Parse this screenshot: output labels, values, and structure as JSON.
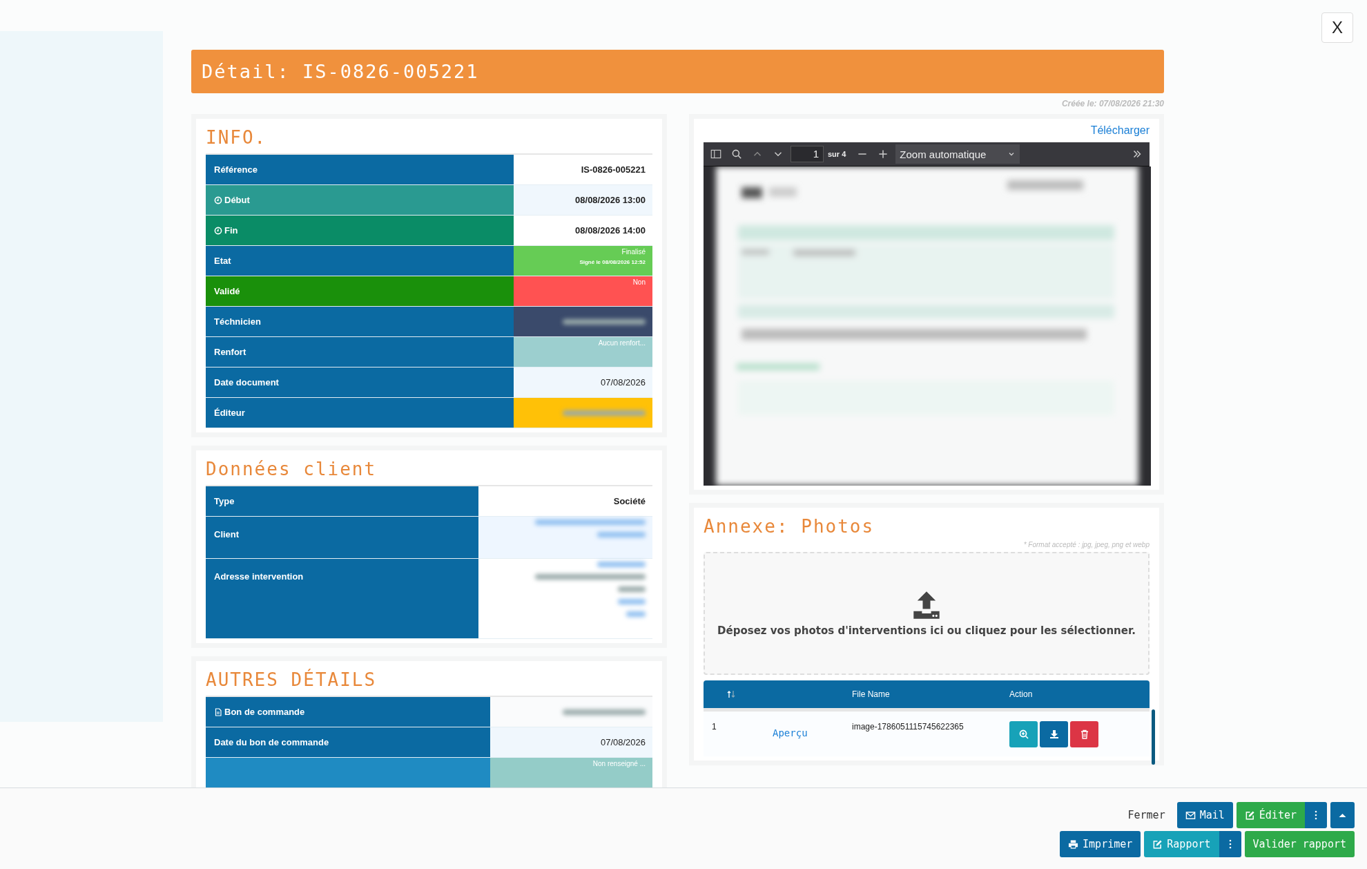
{
  "close_button": {
    "label": "X"
  },
  "header": {
    "title": "Détail: IS-0826-005221"
  },
  "created": {
    "label": "Créée le:",
    "value": "07/08/2026 21:30"
  },
  "info": {
    "title": "INFO.",
    "rows": [
      {
        "label": "Référence",
        "color": "#0b6aa2",
        "kind": "bold",
        "value": {
          "text": "IS-0826-005221"
        }
      },
      {
        "label": "Début",
        "color": "#2a9a91",
        "kind": "bold",
        "value": {
          "text": "08/08/2026 13:00"
        }
      },
      {
        "label": "Fin",
        "color": "#0a8c66",
        "kind": "bold",
        "value": {
          "text": "08/08/2026 14:00"
        }
      },
      {
        "label": "Etat",
        "color": "#0b6aa2",
        "kind": "badge",
        "value": {
          "text": "Finalisé",
          "note": "Signé le 08/08/2026 12:52",
          "color": "#66cc55"
        }
      },
      {
        "label": "Validé",
        "color": "#1a900b",
        "kind": "badge",
        "value": {
          "text": "Non",
          "color": "#ff5252"
        }
      },
      {
        "label": "Téchnicien",
        "color": "#0b6aa2",
        "kind": "blurred",
        "value": {
          "color": "#3a4a6b"
        }
      },
      {
        "label": "Renfort",
        "color": "#0b6aa2",
        "kind": "badge",
        "value": {
          "text": "Aucun renfort...",
          "color": "#9ccfcf"
        }
      },
      {
        "label": "Date document",
        "color": "#0b6aa2",
        "kind": "plain",
        "value": {
          "text": "07/08/2026"
        }
      },
      {
        "label": "Éditeur",
        "color": "#0b6aa2",
        "kind": "blurred",
        "value": {
          "color": "#ffc107"
        }
      }
    ]
  },
  "client": {
    "title": "Données client",
    "rows": [
      {
        "label": "Type",
        "color": "#0b6aa2",
        "kind": "bold",
        "value": {
          "text": "Société"
        }
      },
      {
        "label": "Client",
        "color": "#0b6aa2",
        "kind": "blurred_link",
        "value": {
          "color": "#eef6ff"
        }
      },
      {
        "label": "Adresse intervention",
        "color": "#0b6aa2",
        "kind": "blurred_address",
        "value": {
          "color": "#ffffff"
        }
      }
    ]
  },
  "other": {
    "title": "AUTRES DÉTAILS",
    "rows": [
      {
        "label": "Bon de commande",
        "color": "#0b6aa2",
        "kind": "blurred",
        "value": {
          "color": "#fafbfc"
        }
      },
      {
        "label": "Date du bon de commande",
        "color": "#0b6aa2",
        "kind": "plain",
        "value": {
          "text": "07/08/2026"
        }
      },
      {
        "color": "#1f8bc2",
        "kind": "badge",
        "value": {
          "text": "Non renseigné ...",
          "color": "#94ccc8"
        }
      }
    ]
  },
  "viewer": {
    "download": "Télécharger",
    "page": "1",
    "of": "sur 4",
    "zoom": "Zoom automatique"
  },
  "photos": {
    "title": "Annexe: Photos",
    "note": "* Format accepté : jpg, jpeg, png et webp",
    "drop_text": "Déposez vos photos d'interventions ici ou cliquez pour les sélectionner.",
    "columns": [
      "File Name",
      "Action"
    ],
    "rows": [
      {
        "index": "1",
        "preview": "Aperçu",
        "file": "image-1786051115745622365"
      }
    ]
  },
  "footer": {
    "rows": [
      [
        {
          "kind": "link",
          "label": "Fermer"
        },
        {
          "kind": "button",
          "label": "Mail",
          "color": "#0b6aa2"
        },
        {
          "kind": "split",
          "label": "Éditer",
          "color": "#2eaa4a"
        },
        {
          "kind": "icon",
          "color": "#0b6aa2"
        }
      ],
      [
        {
          "kind": "button",
          "label": "Imprimer",
          "color": "#0b6aa2"
        },
        {
          "kind": "split",
          "label": "Rapport",
          "color": "#17a2b8"
        },
        {
          "kind": "button",
          "label": "Valider rapport",
          "color": "#2eaa4a"
        }
      ]
    ]
  }
}
